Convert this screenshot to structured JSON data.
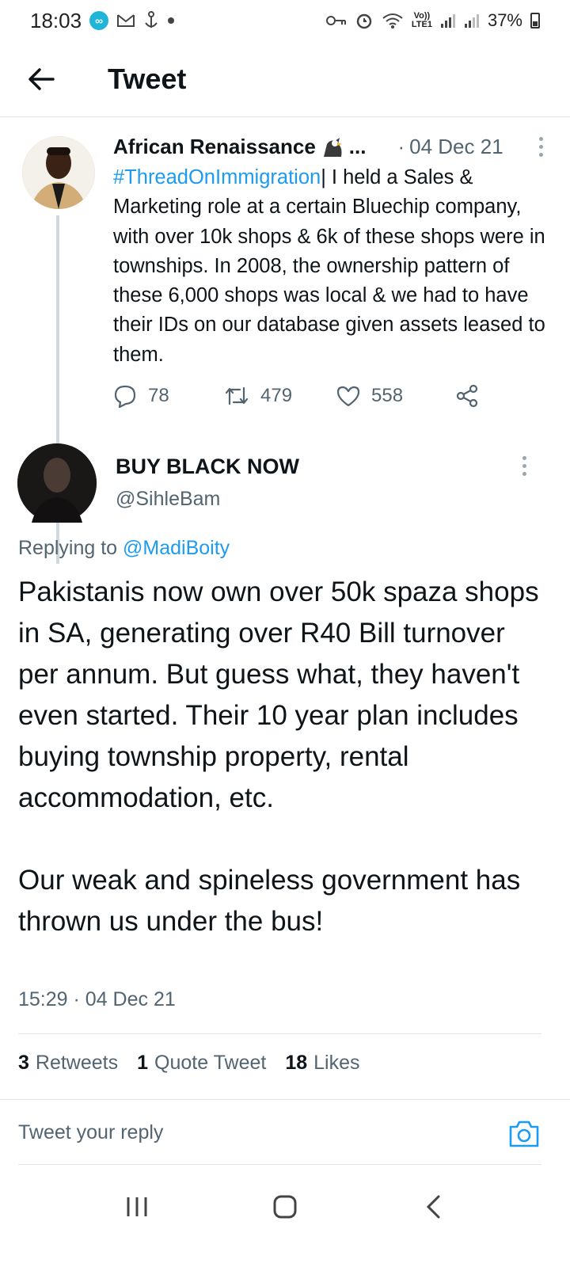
{
  "status_bar": {
    "time": "18:03",
    "left_icons": [
      "meta-app-icon",
      "gmail-icon",
      "anchor-icon",
      "dot-icon"
    ],
    "right_icons": [
      "key-icon",
      "alarm-icon",
      "wifi-icon",
      "lte-icon",
      "signal-icon",
      "signal-icon"
    ],
    "lte_top": "Vo))",
    "lte_bottom": "LTE1",
    "battery": "37%"
  },
  "app_bar": {
    "title": "Tweet"
  },
  "parent_tweet": {
    "author_name": "African Renaissance",
    "ellipsis": "...",
    "dot": "·",
    "date": "04 Dec 21",
    "hashtag": "#ThreadOnImmigration",
    "text": "| I held a Sales & Marketing role at a certain Bluechip company, with over 10k shops & 6k of these shops were in townships. In 2008, the ownership pattern of these 6,000 shops was local & we had to have their IDs on our database given assets leased to them.",
    "replies": "78",
    "retweets": "479",
    "likes": "558"
  },
  "main_tweet": {
    "author_name": "BUY BLACK NOW",
    "handle": "@SihleBam",
    "replying_prefix": "Replying to",
    "replying_to": "@MadiBoity",
    "text": "Pakistanis now own over 50k spaza shops in SA, generating over R40 Bill turnover per annum. But guess what, they haven't even started. Their 10 year plan includes buying township property, rental accommodation, etc.\n\nOur weak and spineless government has thrown us under the bus!",
    "time": "15:29",
    "dot": "·",
    "date": "04 Dec 21",
    "retweets_count": "3",
    "retweets_label": "Retweets",
    "quote_count": "1",
    "quote_label": "Quote Tweet",
    "likes_count": "18",
    "likes_label": "Likes"
  },
  "reply": {
    "placeholder": "Tweet your reply"
  },
  "colors": {
    "link": "#1d9bf0",
    "secondary_text": "#536471",
    "divider": "#e1e5e8"
  }
}
